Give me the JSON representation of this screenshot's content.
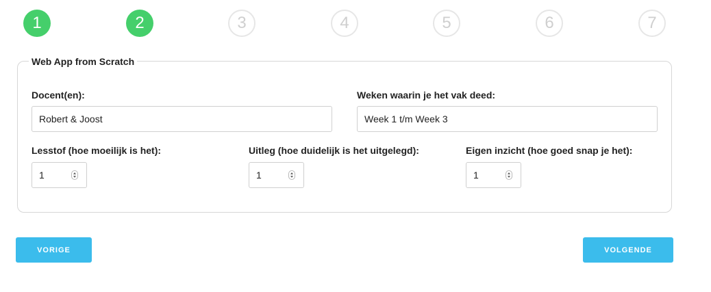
{
  "steps": [
    {
      "label": "1",
      "state": "done"
    },
    {
      "label": "2",
      "state": "done"
    },
    {
      "label": "3",
      "state": "todo"
    },
    {
      "label": "4",
      "state": "todo"
    },
    {
      "label": "5",
      "state": "todo"
    },
    {
      "label": "6",
      "state": "todo"
    },
    {
      "label": "7",
      "state": "todo"
    }
  ],
  "form": {
    "legend": "Web App from Scratch",
    "teachers_label": "Docent(en):",
    "teachers_value": "Robert & Joost",
    "weeks_label": "Weken waarin je het vak deed:",
    "weeks_value": "Week 1 t/m Week 3",
    "material_label": "Lesstof (hoe moeilijk is het):",
    "material_value": "1",
    "explanation_label": "Uitleg (hoe duidelijk is het uitgelegd):",
    "explanation_value": "1",
    "insight_label": "Eigen inzicht (hoe goed snap je het):",
    "insight_value": "1"
  },
  "nav": {
    "prev_label": "VORIGE",
    "next_label": "VOLGENDE"
  },
  "colors": {
    "step_done": "#45cf6b",
    "step_todo_border": "#e6e6e6",
    "button": "#3bbcec"
  }
}
